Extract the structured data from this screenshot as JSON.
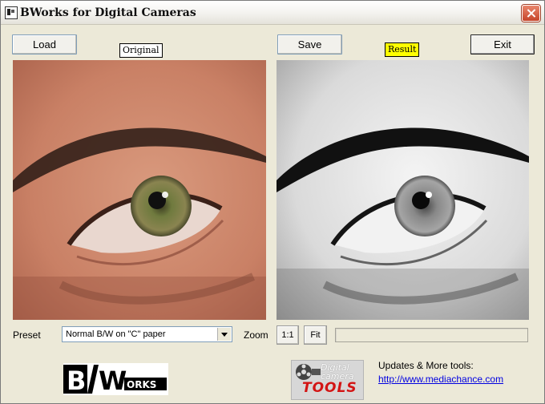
{
  "window": {
    "title": "BWorks for Digital Cameras"
  },
  "toolbar": {
    "load_label": "Load",
    "save_label": "Save",
    "exit_label": "Exit",
    "original_label": "Original",
    "result_label": "Result"
  },
  "controls": {
    "preset_label": "Preset",
    "preset_value": "Normal B/W on \"C\" paper",
    "zoom_label": "Zoom",
    "zoom_1to1_label": "1:1",
    "zoom_fit_label": "Fit",
    "progress": 0
  },
  "footer": {
    "logo_bw": "B",
    "logo_works": "WORKS",
    "tools_logo_top": "Digital camera",
    "tools_logo_bottom": "TOOLS",
    "updates_label": "Updates & More tools:",
    "website_link": "http://www.mediachance.com"
  },
  "colors": {
    "result_badge": "#ffff00",
    "window_bg": "#ece9d8",
    "link": "#0000e0",
    "tools_logo_text": "#d31414"
  }
}
